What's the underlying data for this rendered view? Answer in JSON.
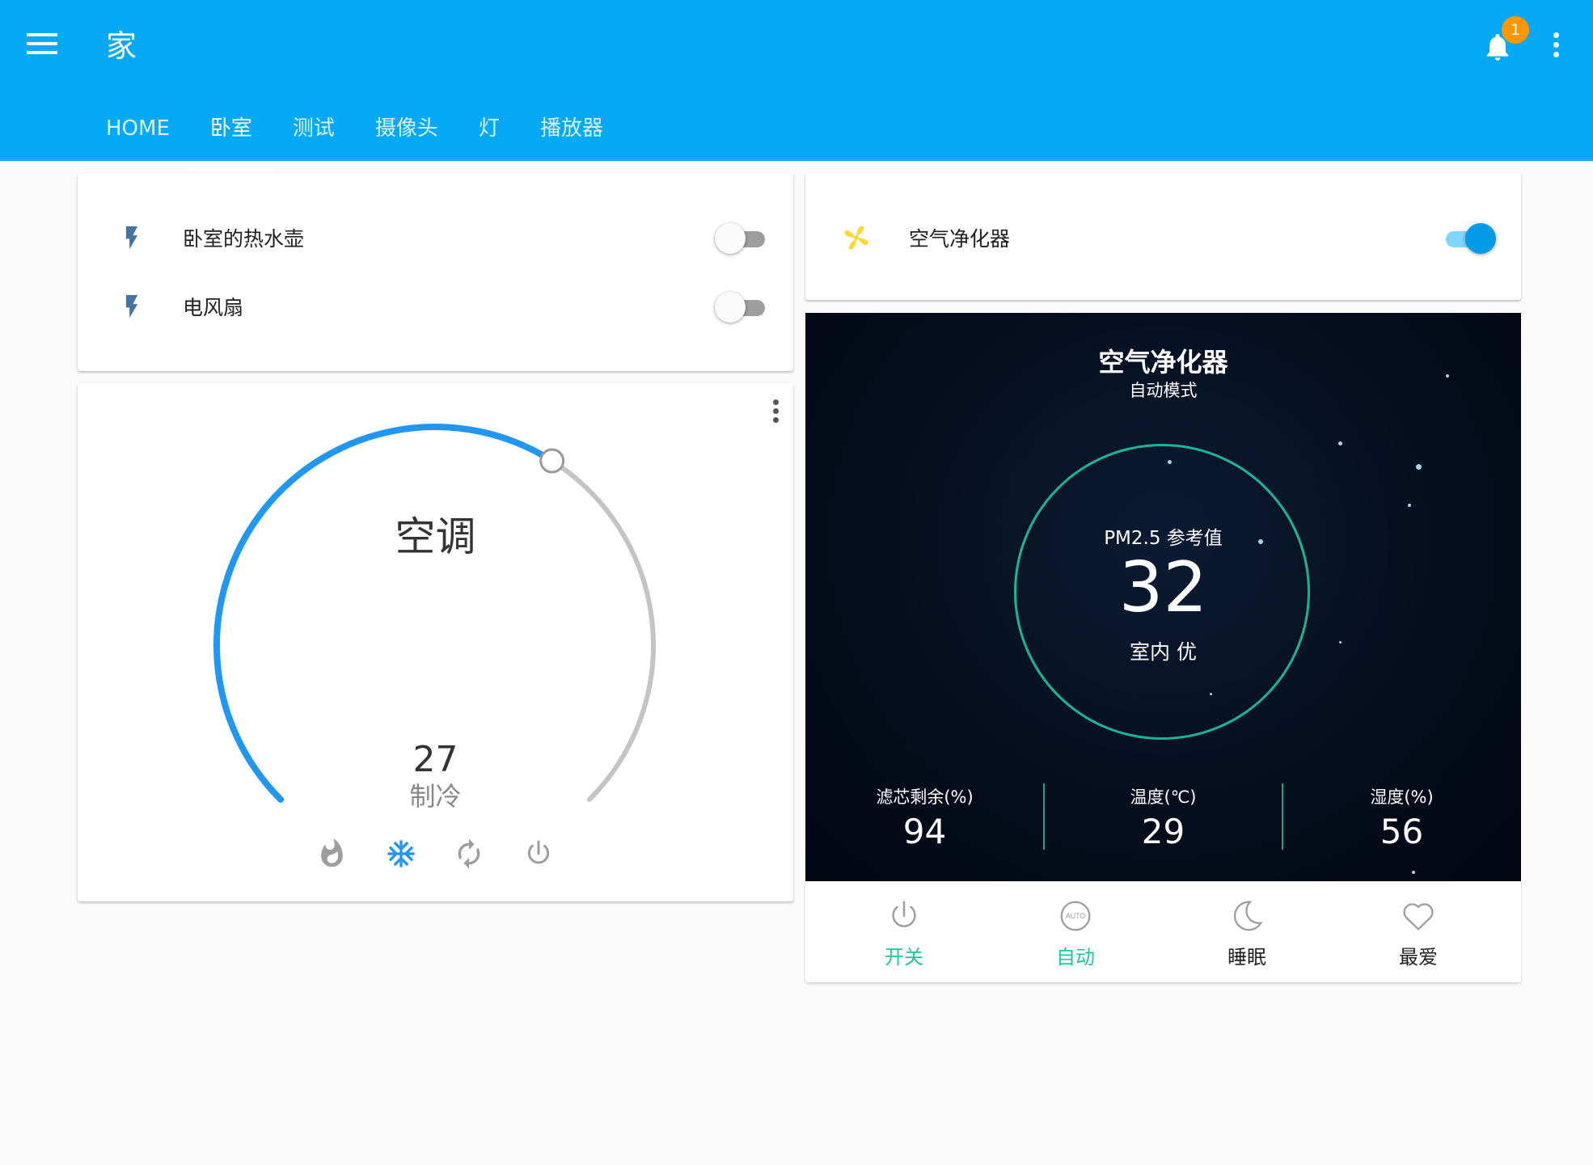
{
  "header": {
    "title": "家",
    "notification_count": "1",
    "tabs": [
      {
        "label": "HOME",
        "active": false
      },
      {
        "label": "卧室",
        "active": true
      },
      {
        "label": "测试",
        "active": false
      },
      {
        "label": "摄像头",
        "active": false
      },
      {
        "label": "灯",
        "active": false
      },
      {
        "label": "播放器",
        "active": false
      }
    ]
  },
  "switches_card": {
    "items": [
      {
        "name": "卧室的热水壶",
        "icon": "flash-icon",
        "state": "off"
      },
      {
        "name": "电风扇",
        "icon": "flash-icon",
        "state": "off"
      }
    ]
  },
  "purifier_switch_card": {
    "name": "空气净化器",
    "icon": "fan-icon",
    "state": "on",
    "icon_color": "#fdd835"
  },
  "thermostat": {
    "name": "空调",
    "temperature": "27",
    "mode": "制冷",
    "setpoint_fraction": 0.62,
    "accent_color": "#2196f3",
    "modes": [
      {
        "name": "heat",
        "icon": "flame-icon",
        "active": false
      },
      {
        "name": "cool",
        "icon": "snowflake-icon",
        "active": true
      },
      {
        "name": "auto",
        "icon": "refresh-icon",
        "active": false
      },
      {
        "name": "off",
        "icon": "power-icon",
        "active": false
      }
    ]
  },
  "purifier": {
    "title": "空气净化器",
    "subtitle": "自动模式",
    "pm25_label": "PM2.5 参考值",
    "pm25_value": "32",
    "quality": "室内 优",
    "ring_color": "#18b59a",
    "stats": [
      {
        "label": "滤芯剩余(%)",
        "value": "94"
      },
      {
        "label": "温度(℃)",
        "value": "29"
      },
      {
        "label": "湿度(%)",
        "value": "56"
      }
    ],
    "actions": [
      {
        "label": "开关",
        "icon": "power-icon",
        "active": true
      },
      {
        "label": "自动",
        "icon": "auto-icon",
        "active": true
      },
      {
        "label": "睡眠",
        "icon": "moon-icon",
        "active": false
      },
      {
        "label": "最爱",
        "icon": "heart-icon",
        "active": false
      }
    ],
    "active_color": "#1bc69e"
  }
}
